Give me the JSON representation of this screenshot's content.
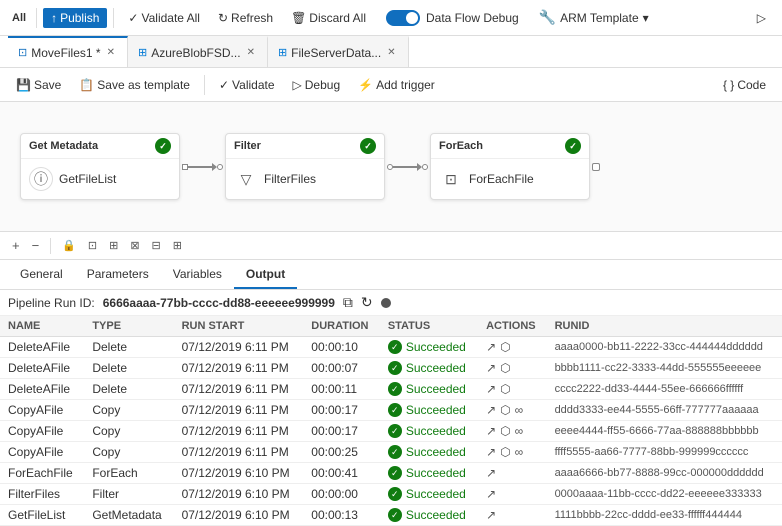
{
  "topToolbar": {
    "publishBtn": "Publish",
    "validateAllBtn": "Validate All",
    "refreshBtn": "Refresh",
    "discardAllBtn": "Discard All",
    "dataFlowDebugLabel": "Data Flow Debug",
    "armTemplateLabel": "ARM Template",
    "runBtn": "▷"
  },
  "tabs": [
    {
      "id": "movefiles",
      "label": "MoveFiles1 *",
      "icon": "pipeline",
      "active": false
    },
    {
      "id": "azureblob",
      "label": "AzureBlobFSD...",
      "icon": "dataset",
      "active": false
    },
    {
      "id": "fileserver",
      "label": "FileServerData...",
      "icon": "dataset",
      "active": true
    }
  ],
  "actionToolbar": {
    "saveBtn": "Save",
    "saveAsTemplateBtn": "Save as template",
    "validateBtn": "Validate",
    "debugBtn": "Debug",
    "addTriggerBtn": "Add trigger",
    "codeBtn": "Code"
  },
  "pipeline": {
    "nodes": [
      {
        "id": "getmetadata",
        "header": "Get Metadata",
        "icon": "⊙",
        "label": "GetFileList",
        "success": true
      },
      {
        "id": "filter",
        "header": "Filter",
        "icon": "▽",
        "label": "FilterFiles",
        "success": true
      },
      {
        "id": "foreach",
        "header": "ForEach",
        "icon": "⊡",
        "label": "ForEachFile",
        "success": true
      }
    ]
  },
  "canvasToolbar": {
    "addBtn": "+",
    "removeBtn": "−",
    "lockBtn": "🔒",
    "fitBtn": "⊡",
    "zoomInBtn": "⊞",
    "selectionBtn": "⊠",
    "layoutBtn": "⊟",
    "moreBtn": "⊞"
  },
  "panelTabs": [
    "General",
    "Parameters",
    "Variables",
    "Output"
  ],
  "activePanelTab": "Output",
  "runInfo": {
    "label": "Pipeline Run ID:",
    "id": "6666aaaa-77bb-cccc-dd88-eeeeee999999"
  },
  "tableHeaders": [
    "NAME",
    "TYPE",
    "RUN START",
    "DURATION",
    "STATUS",
    "ACTIONS",
    "RUNID"
  ],
  "tableRows": [
    {
      "name": "DeleteAFile",
      "type": "Delete",
      "runStart": "07/12/2019 6:11 PM",
      "duration": "00:00:10",
      "status": "Succeeded",
      "hasLink": true,
      "hasShare": true,
      "hasInfinity": false,
      "runId": "aaaa0000-bb11-2222-33cc-444444dddddd"
    },
    {
      "name": "DeleteAFile",
      "type": "Delete",
      "runStart": "07/12/2019 6:11 PM",
      "duration": "00:00:07",
      "status": "Succeeded",
      "hasLink": true,
      "hasShare": true,
      "hasInfinity": false,
      "runId": "bbbb1111-cc22-3333-44dd-555555eeeeee"
    },
    {
      "name": "DeleteAFile",
      "type": "Delete",
      "runStart": "07/12/2019 6:11 PM",
      "duration": "00:00:11",
      "status": "Succeeded",
      "hasLink": true,
      "hasShare": true,
      "hasInfinity": false,
      "runId": "cccc2222-dd33-4444-55ee-666666ffffff"
    },
    {
      "name": "CopyAFile",
      "type": "Copy",
      "runStart": "07/12/2019 6:11 PM",
      "duration": "00:00:17",
      "status": "Succeeded",
      "hasLink": true,
      "hasShare": true,
      "hasInfinity": true,
      "runId": "dddd3333-ee44-5555-66ff-777777aaaaaa"
    },
    {
      "name": "CopyAFile",
      "type": "Copy",
      "runStart": "07/12/2019 6:11 PM",
      "duration": "00:00:17",
      "status": "Succeeded",
      "hasLink": true,
      "hasShare": true,
      "hasInfinity": true,
      "runId": "eeee4444-ff55-6666-77aa-888888bbbbbb"
    },
    {
      "name": "CopyAFile",
      "type": "Copy",
      "runStart": "07/12/2019 6:11 PM",
      "duration": "00:00:25",
      "status": "Succeeded",
      "hasLink": true,
      "hasShare": true,
      "hasInfinity": true,
      "runId": "ffff5555-aa66-7777-88bb-999999cccccc"
    },
    {
      "name": "ForEachFile",
      "type": "ForEach",
      "runStart": "07/12/2019 6:10 PM",
      "duration": "00:00:41",
      "status": "Succeeded",
      "hasLink": true,
      "hasShare": false,
      "hasInfinity": false,
      "runId": "aaaa6666-bb77-8888-99cc-000000dddddd"
    },
    {
      "name": "FilterFiles",
      "type": "Filter",
      "runStart": "07/12/2019 6:10 PM",
      "duration": "00:00:00",
      "status": "Succeeded",
      "hasLink": true,
      "hasShare": false,
      "hasInfinity": false,
      "runId": "0000aaaa-11bb-cccc-dd22-eeeeee333333"
    },
    {
      "name": "GetFileList",
      "type": "GetMetadata",
      "runStart": "07/12/2019 6:10 PM",
      "duration": "00:00:13",
      "status": "Succeeded",
      "hasLink": true,
      "hasShare": false,
      "hasInfinity": false,
      "runId": "1111bbbb-22cc-dddd-ee33-ffffff444444"
    }
  ]
}
